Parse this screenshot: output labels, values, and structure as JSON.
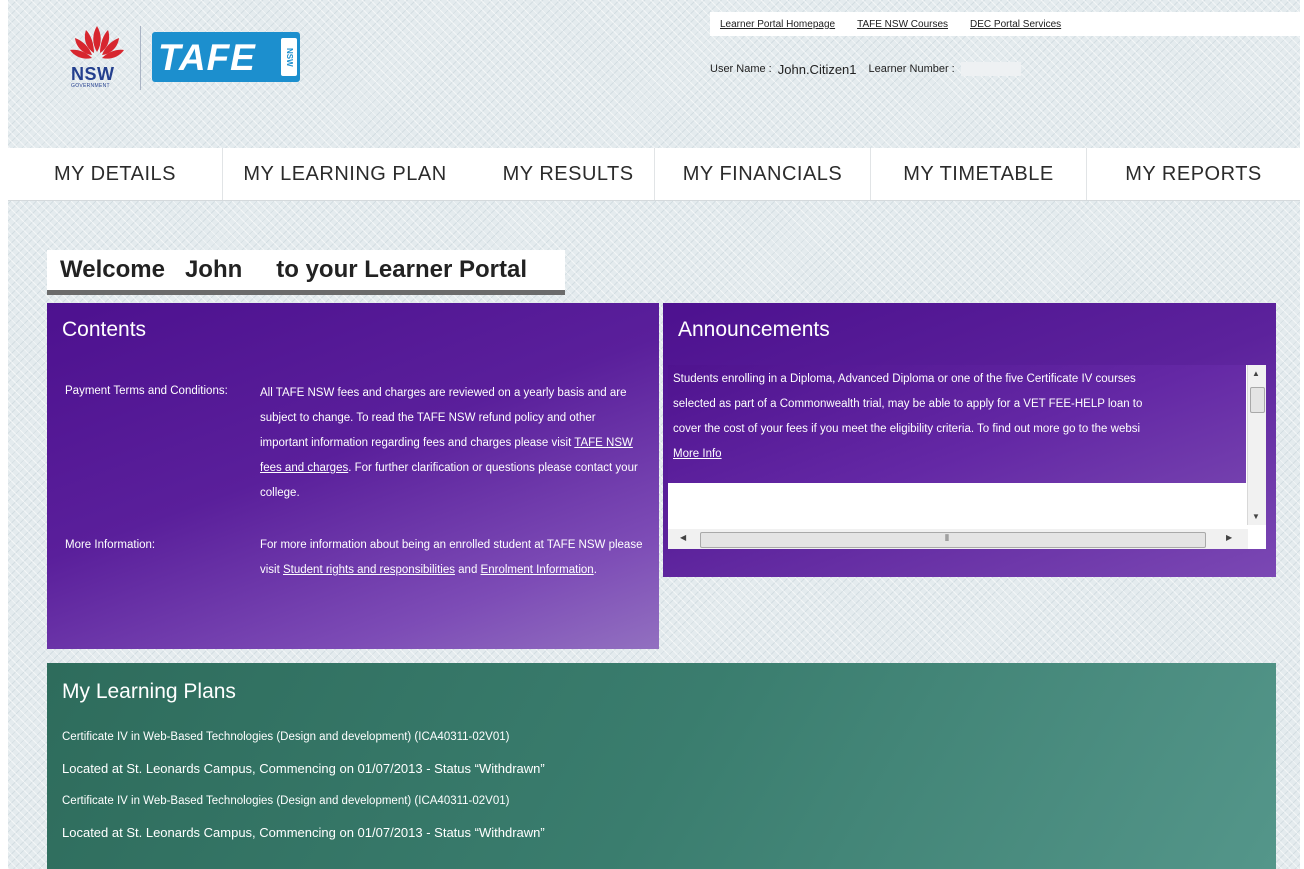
{
  "header": {
    "logo_nsw": "NSW",
    "logo_gov": "GOVERNMENT",
    "logo_tafe": "TAFE",
    "logo_tafe_nsw": "NSW",
    "links": [
      "Learner Portal Homepage",
      "TAFE NSW Courses",
      "DEC Portal Services"
    ],
    "user_name_label": "User Name :",
    "user_name": "John.Citizen1",
    "learner_number_label": "Learner Number :"
  },
  "nav": {
    "items": [
      "MY DETAILS",
      "MY LEARNING PLAN",
      "MY RESULTS",
      "MY FINANCIALS",
      "MY TIMETABLE",
      "MY REPORTS"
    ]
  },
  "welcome": {
    "prefix": "Welcome",
    "name": "John",
    "suffix": "to your Learner Portal"
  },
  "contents": {
    "title": "Contents",
    "payment_label": "Payment Terms and Conditions:",
    "payment_text_1": "All TAFE NSW fees and charges are reviewed on a yearly basis and are subject to change. To read the TAFE NSW refund policy and other important information regarding fees and charges please visit ",
    "payment_link": "TAFE NSW fees and charges",
    "payment_text_2": ". For further clarification or questions please contact your college.",
    "more_label": "More Information:",
    "more_text_1": "For more information about being an enrolled student at TAFE NSW please visit ",
    "more_link_1": "Student rights and responsibilities",
    "more_text_2": " and ",
    "more_link_2": "Enrolment Information",
    "more_text_3": "."
  },
  "announcements": {
    "title": "Announcements",
    "lines": [
      "Students enrolling in a Diploma, Advanced Diploma or one of the five Certificate IV courses",
      "selected as part of a Commonwealth trial, may be able to apply for a VET FEE-HELP loan to",
      "cover the cost of your fees if you meet the eligibility criteria. To find out more go to the websi"
    ],
    "more_info": "More Info"
  },
  "plans": {
    "title": "My Learning Plans",
    "items": [
      {
        "course": "Certificate IV in Web-Based Technologies (Design and development) (ICA40311-02V01)",
        "location": "Located at St. Leonards Campus, Commencing on 01/07/2013 - Status “Withdrawn”"
      },
      {
        "course": "Certificate IV in Web-Based Technologies (Design and development) (ICA40311-02V01)",
        "location": "Located at St. Leonards Campus, Commencing on 01/07/2013 - Status “Withdrawn”"
      }
    ]
  }
}
